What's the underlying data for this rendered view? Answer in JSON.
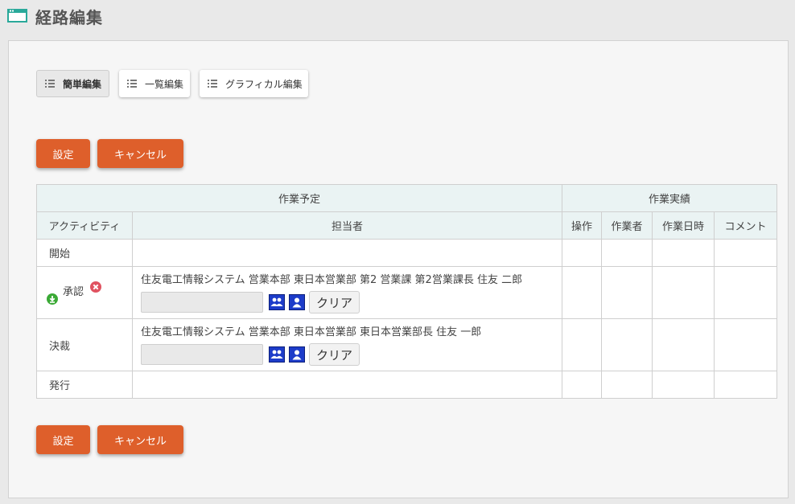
{
  "page": {
    "title": "経路編集"
  },
  "tabs": [
    {
      "label": "簡単編集",
      "active": true
    },
    {
      "label": "一覧編集",
      "active": false
    },
    {
      "label": "グラフィカル編集",
      "active": false
    }
  ],
  "actions": {
    "set_label": "設定",
    "cancel_label": "キャンセル"
  },
  "table": {
    "group_plan": "作業予定",
    "group_result": "作業実績",
    "col_activity": "アクティビティ",
    "col_assignee": "担当者",
    "col_operation": "操作",
    "col_worker": "作業者",
    "col_datetime": "作業日時",
    "col_comment": "コメント",
    "rows": [
      {
        "activity": "開始",
        "assignee": ""
      },
      {
        "activity": "承認",
        "assignee": "住友電工情報システム 営業本部 東日本営業部 第2 営業課 第2営業課長 住友 二郎",
        "input_value": "",
        "clear_label": "クリア"
      },
      {
        "activity": "決裁",
        "assignee": "住友電工情報システム 営業本部 東日本営業部 東日本営業部長 住友 一郎",
        "input_value": "",
        "clear_label": "クリア"
      },
      {
        "activity": "発行",
        "assignee": ""
      }
    ]
  },
  "colors": {
    "accent": "#de5f2b",
    "header_icon": "#2aa99a",
    "table_header": "#eaf3f3",
    "picker": "#1d3cc9"
  }
}
